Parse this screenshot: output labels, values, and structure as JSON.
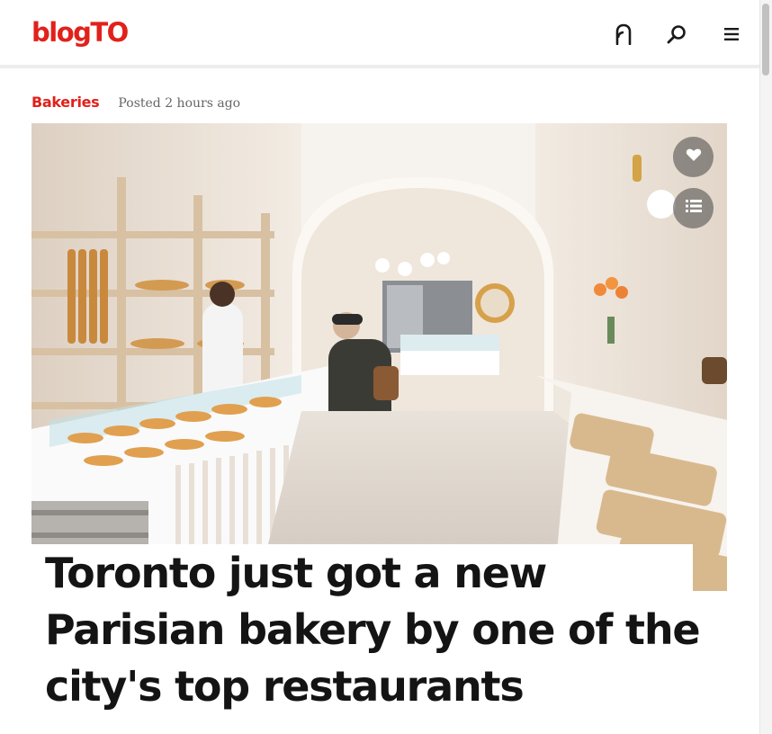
{
  "site": {
    "logo_text": "blogTO",
    "brand_color": "#e1211b"
  },
  "header": {
    "icons": [
      "user-icon",
      "search-icon",
      "menu-icon"
    ]
  },
  "article": {
    "category": "Bakeries",
    "posted": "Posted 2 hours ago",
    "title": "Toronto just got a new Parisian bakery by one of the city's top restaurants",
    "hero_actions": [
      "heart-icon",
      "list-icon"
    ]
  }
}
